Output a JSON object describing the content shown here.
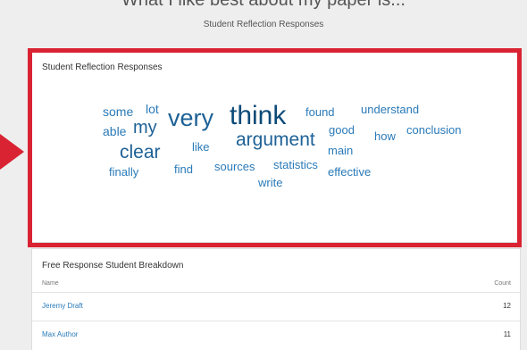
{
  "header": {
    "title": "What I like best about my paper is...",
    "subtitle": "Student Reflection Responses"
  },
  "word_cloud": {
    "title": "Student Reflection Responses",
    "words": [
      {
        "text": "some",
        "color": "#2a7ab8"
      },
      {
        "text": "lot",
        "color": "#2a7ab8"
      },
      {
        "text": "very",
        "color": "#1d6196"
      },
      {
        "text": "think",
        "color": "#0b4a78"
      },
      {
        "text": "found",
        "color": "#2a7ab8"
      },
      {
        "text": "understand",
        "color": "#2a7ab8"
      },
      {
        "text": "able",
        "color": "#2a7ab8"
      },
      {
        "text": "my",
        "color": "#1d6196"
      },
      {
        "text": "argument",
        "color": "#1d6196"
      },
      {
        "text": "good",
        "color": "#2a7ab8"
      },
      {
        "text": "how",
        "color": "#2a7ab8"
      },
      {
        "text": "conclusion",
        "color": "#2a7ab8"
      },
      {
        "text": "clear",
        "color": "#1d6196"
      },
      {
        "text": "like",
        "color": "#2a7ab8"
      },
      {
        "text": "main",
        "color": "#2a7ab8"
      },
      {
        "text": "finally",
        "color": "#2a7ab8"
      },
      {
        "text": "find",
        "color": "#2a7ab8"
      },
      {
        "text": "sources",
        "color": "#2a7ab8"
      },
      {
        "text": "statistics",
        "color": "#2a7ab8"
      },
      {
        "text": "effective",
        "color": "#2a7ab8"
      },
      {
        "text": "write",
        "color": "#2a7ab8"
      }
    ]
  },
  "breakdown": {
    "title": "Free Response Student Breakdown",
    "columns": {
      "name": "Name",
      "count": "Count"
    },
    "rows": [
      {
        "name": "Jeremy Draft",
        "count": "12"
      },
      {
        "name": "Max Author",
        "count": "11"
      }
    ]
  },
  "colors": {
    "highlight": "#d92332",
    "link": "#2a7ab8"
  }
}
